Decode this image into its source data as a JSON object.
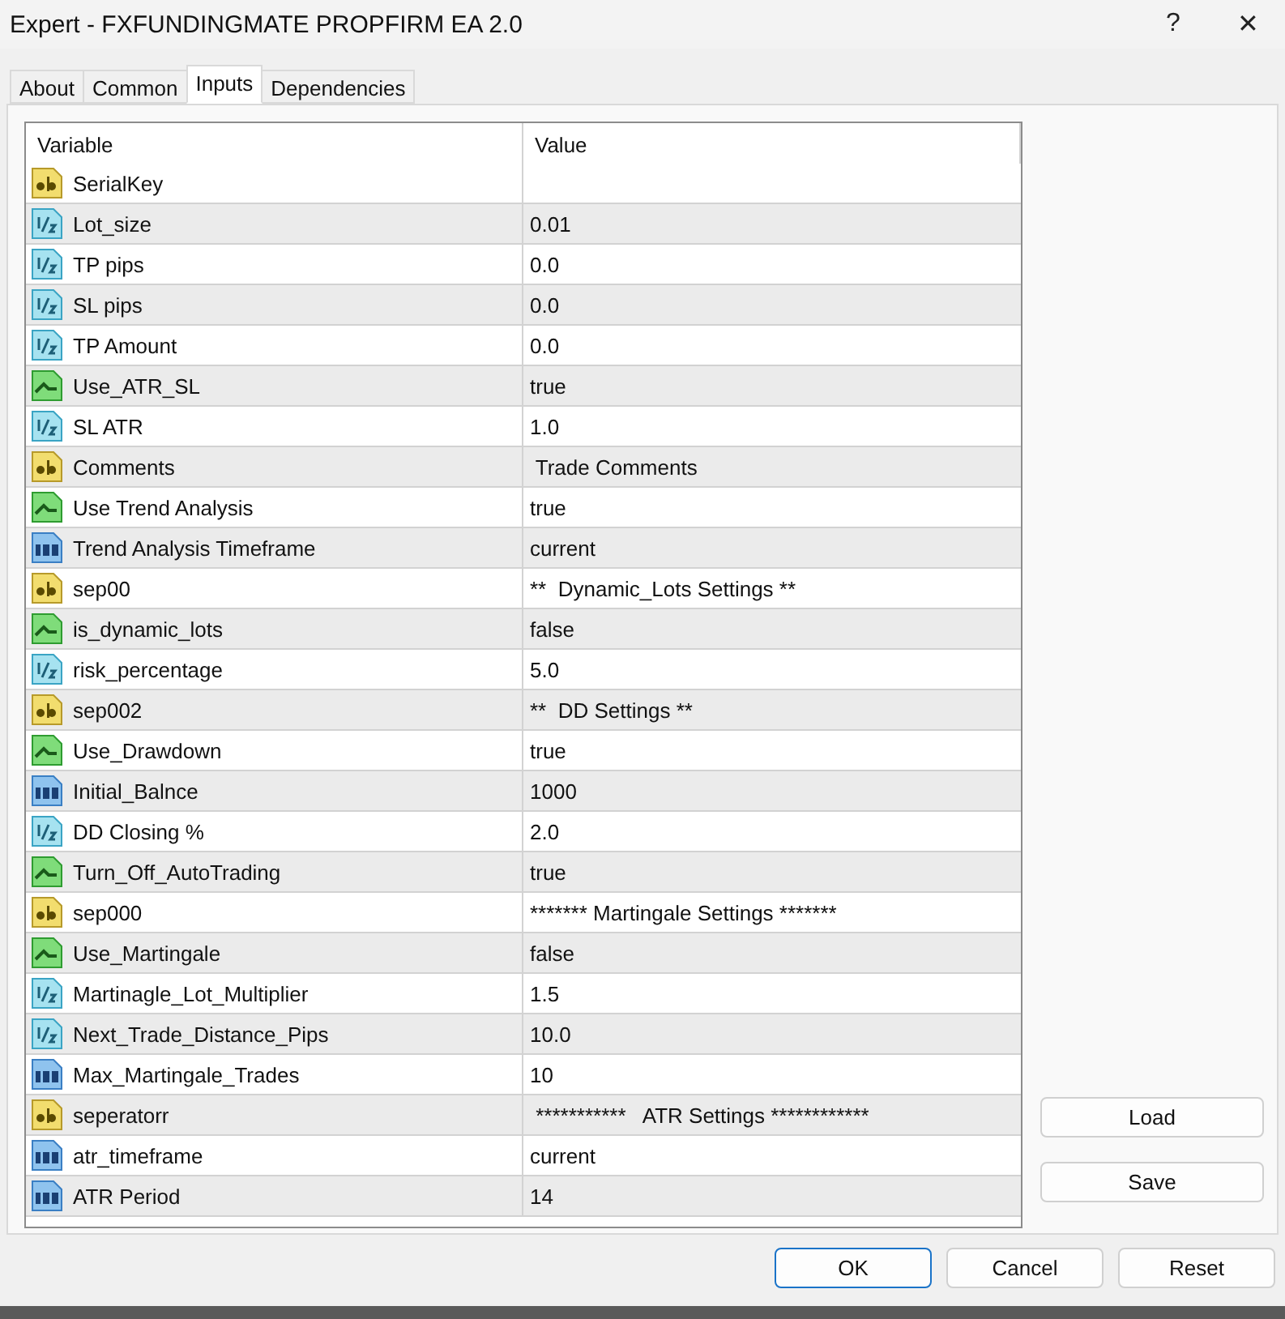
{
  "window": {
    "title": "Expert - FXFUNDINGMATE PROPFIRM EA 2.0",
    "help": "?",
    "close": "✕"
  },
  "tabs": [
    {
      "label": "About",
      "selected": false
    },
    {
      "label": "Common",
      "selected": false
    },
    {
      "label": "Inputs",
      "selected": true
    },
    {
      "label": "Dependencies",
      "selected": false
    }
  ],
  "table": {
    "columns": [
      "Variable",
      "Value"
    ],
    "rows": [
      {
        "kind": "string",
        "variable": "SerialKey",
        "value": ""
      },
      {
        "kind": "double",
        "variable": "Lot_size",
        "value": "0.01"
      },
      {
        "kind": "double",
        "variable": "TP pips",
        "value": "0.0"
      },
      {
        "kind": "double",
        "variable": "SL pips",
        "value": "0.0"
      },
      {
        "kind": "double",
        "variable": "TP Amount",
        "value": "0.0"
      },
      {
        "kind": "bool",
        "variable": "Use_ATR_SL",
        "value": "true"
      },
      {
        "kind": "double",
        "variable": "SL ATR",
        "value": "1.0"
      },
      {
        "kind": "string",
        "variable": "Comments",
        "value": " Trade Comments"
      },
      {
        "kind": "bool",
        "variable": "Use Trend Analysis",
        "value": "true"
      },
      {
        "kind": "int",
        "variable": "Trend Analysis Timeframe",
        "value": "current"
      },
      {
        "kind": "string",
        "variable": "sep00",
        "value": "**  Dynamic_Lots Settings **"
      },
      {
        "kind": "bool",
        "variable": "is_dynamic_lots",
        "value": "false"
      },
      {
        "kind": "double",
        "variable": "risk_percentage",
        "value": "5.0"
      },
      {
        "kind": "string",
        "variable": "sep002",
        "value": "**  DD Settings **"
      },
      {
        "kind": "bool",
        "variable": "Use_Drawdown",
        "value": "true"
      },
      {
        "kind": "int",
        "variable": "Initial_Balnce",
        "value": "1000"
      },
      {
        "kind": "double",
        "variable": "DD Closing %",
        "value": "2.0"
      },
      {
        "kind": "bool",
        "variable": "Turn_Off_AutoTrading",
        "value": "true"
      },
      {
        "kind": "string",
        "variable": "sep000",
        "value": "******* Martingale Settings *******"
      },
      {
        "kind": "bool",
        "variable": "Use_Martingale",
        "value": "false"
      },
      {
        "kind": "double",
        "variable": "Martinagle_Lot_Multiplier",
        "value": "1.5"
      },
      {
        "kind": "double",
        "variable": "Next_Trade_Distance_Pips",
        "value": "10.0"
      },
      {
        "kind": "int",
        "variable": "Max_Martingale_Trades",
        "value": "10"
      },
      {
        "kind": "string",
        "variable": "seperatorr",
        "value": " ***********   ATR Settings ************"
      },
      {
        "kind": "int",
        "variable": "atr_timeframe",
        "value": "current"
      },
      {
        "kind": "int",
        "variable": "ATR Period",
        "value": "14"
      }
    ]
  },
  "side_buttons": [
    "Load",
    "Save"
  ],
  "buttons": [
    {
      "label": "OK",
      "default": true
    },
    {
      "label": "Cancel",
      "default": false
    },
    {
      "label": "Reset",
      "default": false
    }
  ]
}
